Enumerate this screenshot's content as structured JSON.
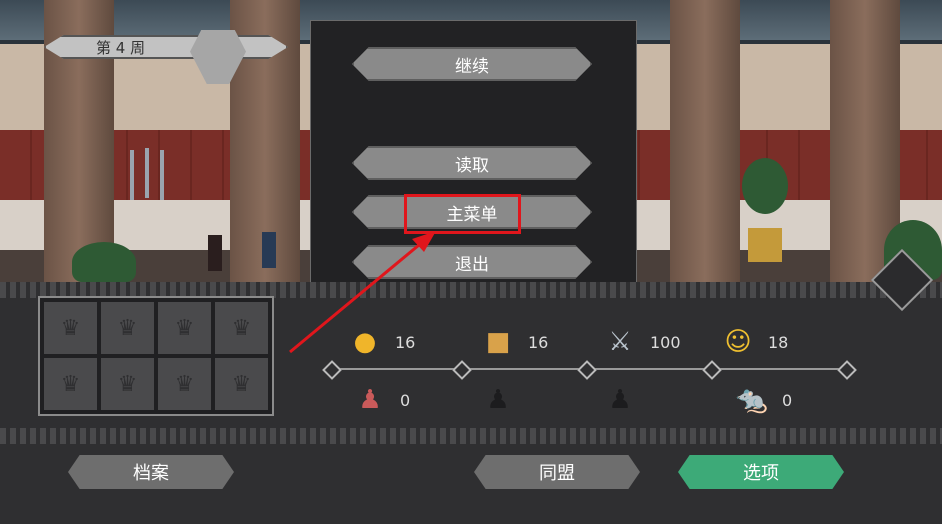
{
  "hud": {
    "week_label": "第 4 周"
  },
  "pause_menu": {
    "continue_label": "继续",
    "load_label": "读取",
    "main_menu_label": "主菜单",
    "quit_label": "退出"
  },
  "resources": {
    "food": "16",
    "gold": "16",
    "weapons": "100",
    "morale": "18",
    "advisors": "0",
    "rats": "0"
  },
  "icons": {
    "food": "food-icon",
    "gold": "gold-icon",
    "weapons": "sword-icon",
    "morale": "theater-masks-icon",
    "advisor": "advisor-icon",
    "rat": "rat-icon",
    "crown": "crown-icon"
  },
  "bottom_bar": {
    "archive_label": "档案",
    "alliance_label": "同盟",
    "options_label": "选项"
  },
  "colors": {
    "highlight_box": "#e0161c",
    "options_button": "#3daa78",
    "menu_button": "#8a8a8a"
  }
}
